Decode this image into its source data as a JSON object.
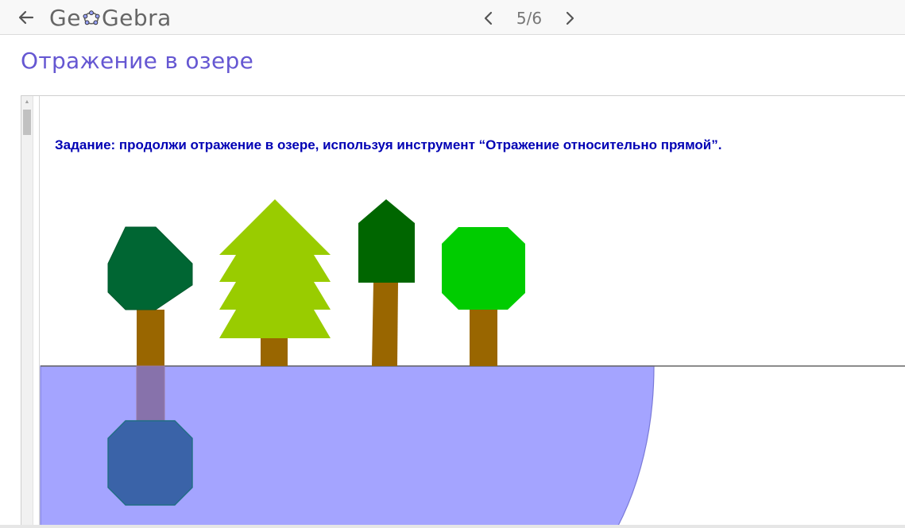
{
  "header": {
    "logo_text_left": "Ge",
    "logo_text_right": "Gebra",
    "pager_text": "5/6",
    "icons": {
      "back": "arrow-left-icon",
      "prev": "chevron-left-icon",
      "next": "chevron-right-icon",
      "logo": "geogebra-logo-icon"
    }
  },
  "page": {
    "title": "Отражение в озере"
  },
  "applet": {
    "task": "Задание: продолжи отражение в озере, используя инструмент “Отражение относительно прямой”.",
    "objects": [
      "round-tree",
      "fir-tree",
      "pointed-tree",
      "light-green-tree",
      "lake",
      "shore-line",
      "reflected-trunk",
      "reflected-crown"
    ]
  },
  "colors": {
    "title": "#6557d2",
    "task_text": "#0000b4",
    "lake": "#a4a4ff",
    "lake_edge": "#7a7ad8",
    "trunk": "#996600",
    "dark_green": "#006633",
    "fir_green": "#99cc00",
    "forest_green": "#006600",
    "bright_green": "#00cc00",
    "reflection_trunk": "#8772ab",
    "reflection_crown": "#3a63a8",
    "reflection_edge": "#206e84"
  }
}
